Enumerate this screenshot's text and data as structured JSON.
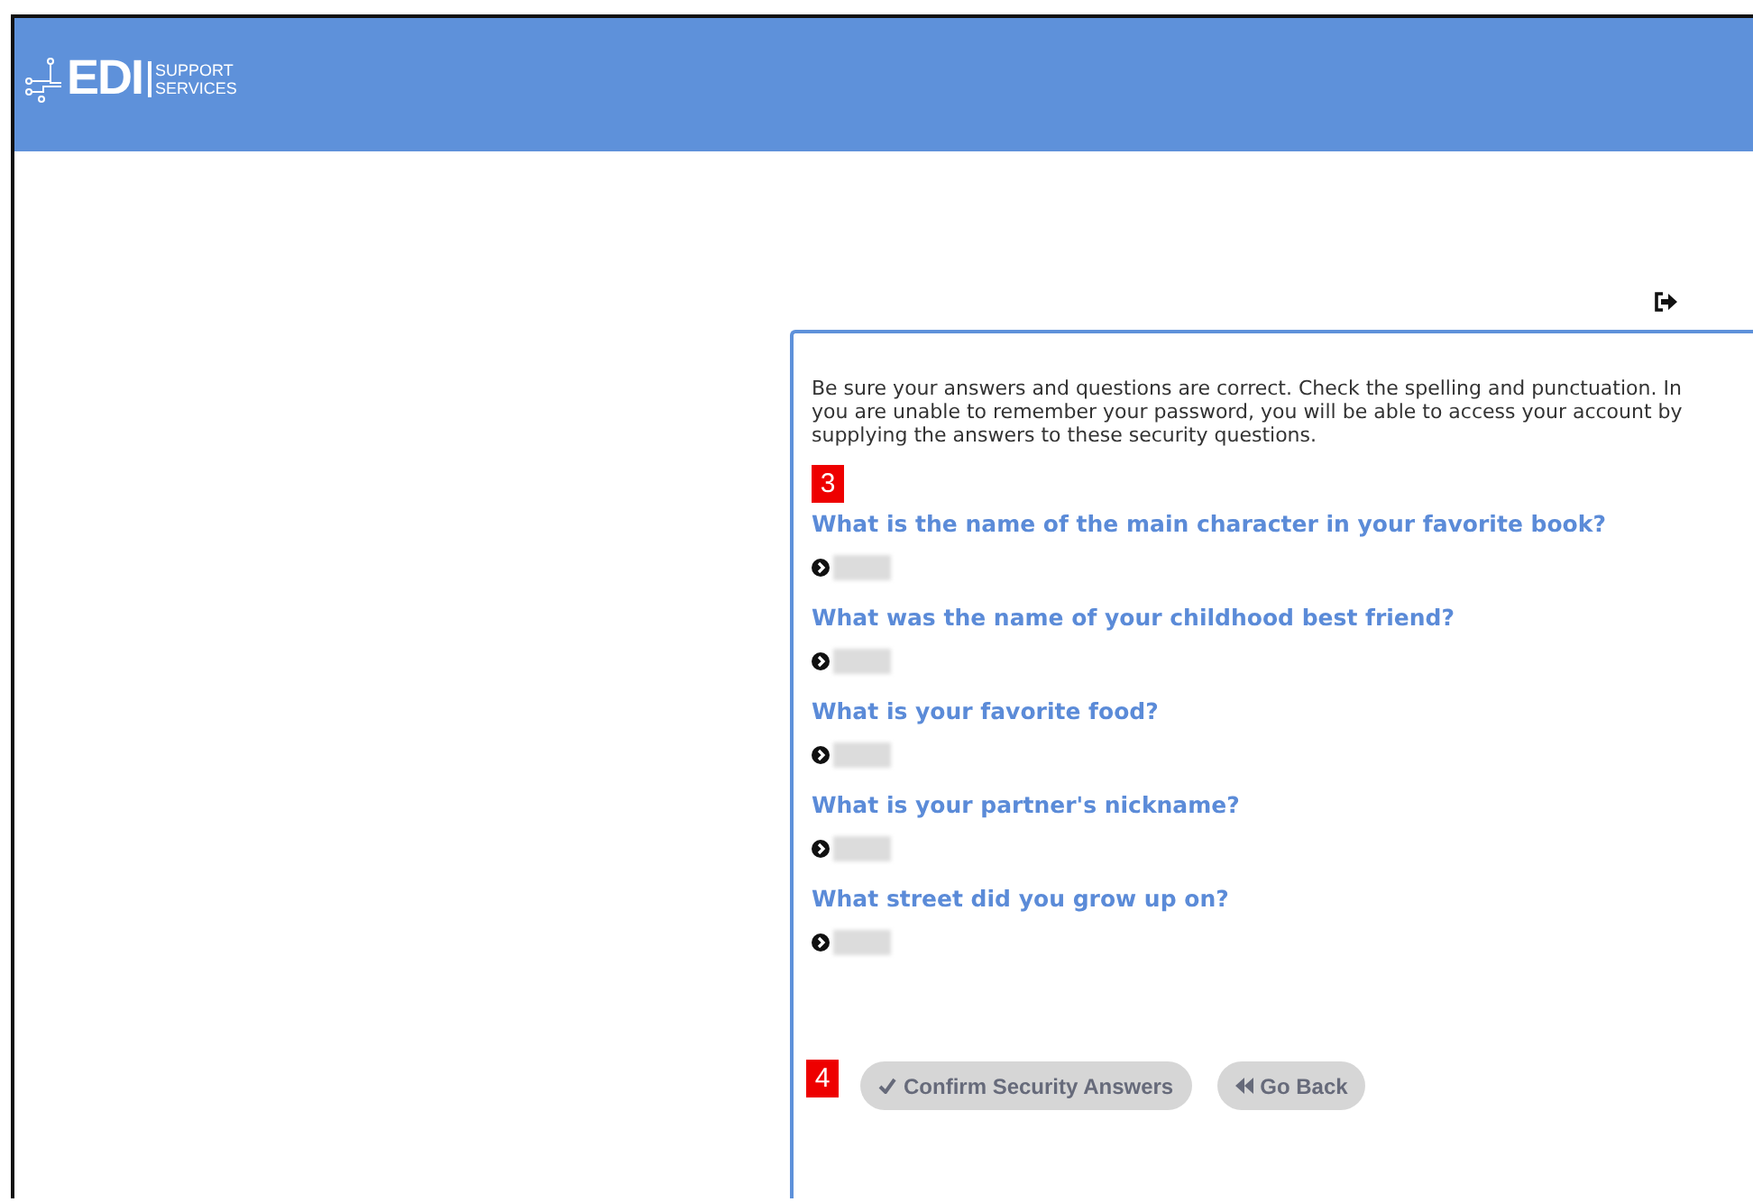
{
  "header": {
    "logo": {
      "mark": "EDI",
      "line_1": "SUPPORT",
      "line_2": "SERVICES"
    }
  },
  "intro": "Be sure your answers and questions are correct. Check the spelling and punctuation. In you are unable to remember your password, you will be able to access your account by supplying the answers to these security questions.",
  "callouts": [
    "3",
    "4"
  ],
  "questions": [
    {
      "question": "What is the name of the main character in your favorite book?",
      "answer_redacted": true
    },
    {
      "question": "What was the name of your childhood best friend?",
      "answer_redacted": true
    },
    {
      "question": "What is your favorite food?",
      "answer_redacted": true
    },
    {
      "question": "What is your partner's nickname?",
      "answer_redacted": true
    },
    {
      "question": "What street did you grow up on?",
      "answer_redacted": true
    }
  ],
  "buttons": [
    {
      "label": "Confirm Security Answers",
      "kind": "confirm"
    },
    {
      "label": "Go Back",
      "kind": "back"
    }
  ]
}
